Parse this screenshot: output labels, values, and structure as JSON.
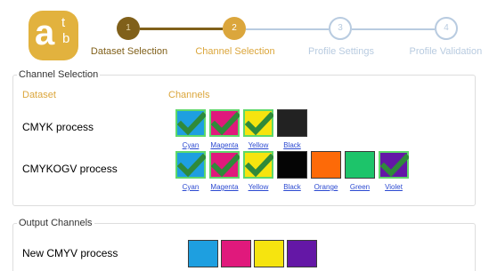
{
  "logo": {
    "letter_main": "a",
    "letter_top": "t",
    "letter_bottom": "b",
    "color": "#e2b23e"
  },
  "stepper": [
    {
      "number": "1",
      "label": "Dataset Selection",
      "state": "done"
    },
    {
      "number": "2",
      "label": "Channel Selection",
      "state": "active"
    },
    {
      "number": "3",
      "label": "Profile Settings",
      "state": "pending"
    },
    {
      "number": "4",
      "label": "Profile Validation",
      "state": "pending"
    }
  ],
  "channel_selection": {
    "legend": "Channel Selection",
    "col_dataset": "Dataset",
    "col_channels": "Channels",
    "rows": [
      {
        "name": "CMYK process",
        "channels": [
          {
            "label": "Cyan",
            "color": "#1e9fe0",
            "checked": true
          },
          {
            "label": "Magenta",
            "color": "#e0197c",
            "checked": true
          },
          {
            "label": "Yellow",
            "color": "#f6e40f",
            "checked": true
          },
          {
            "label": "Black",
            "color": "#222222",
            "checked": false
          }
        ]
      },
      {
        "name": "CMYKOGV process",
        "channels": [
          {
            "label": "Cyan",
            "color": "#1e9fe0",
            "checked": true
          },
          {
            "label": "Magenta",
            "color": "#e0197c",
            "checked": true
          },
          {
            "label": "Yellow",
            "color": "#f6e40f",
            "checked": true
          },
          {
            "label": "Black",
            "color": "#050505",
            "checked": false
          },
          {
            "label": "Orange",
            "color": "#fd6a08",
            "checked": false
          },
          {
            "label": "Green",
            "color": "#1dc46a",
            "checked": false
          },
          {
            "label": "Violet",
            "color": "#6417a6",
            "checked": true
          }
        ]
      }
    ]
  },
  "output_channels": {
    "legend": "Output Channels",
    "name": "New CMYV process",
    "swatches": [
      {
        "color": "#1e9fe0"
      },
      {
        "color": "#e0197c"
      },
      {
        "color": "#f6e40f"
      },
      {
        "color": "#6417a6"
      }
    ]
  },
  "colors": {
    "accent": "#dba63c",
    "done": "#80601a",
    "pending": "#b8cbe0",
    "link": "#2c4ad1",
    "check": "#2f8a3a"
  }
}
